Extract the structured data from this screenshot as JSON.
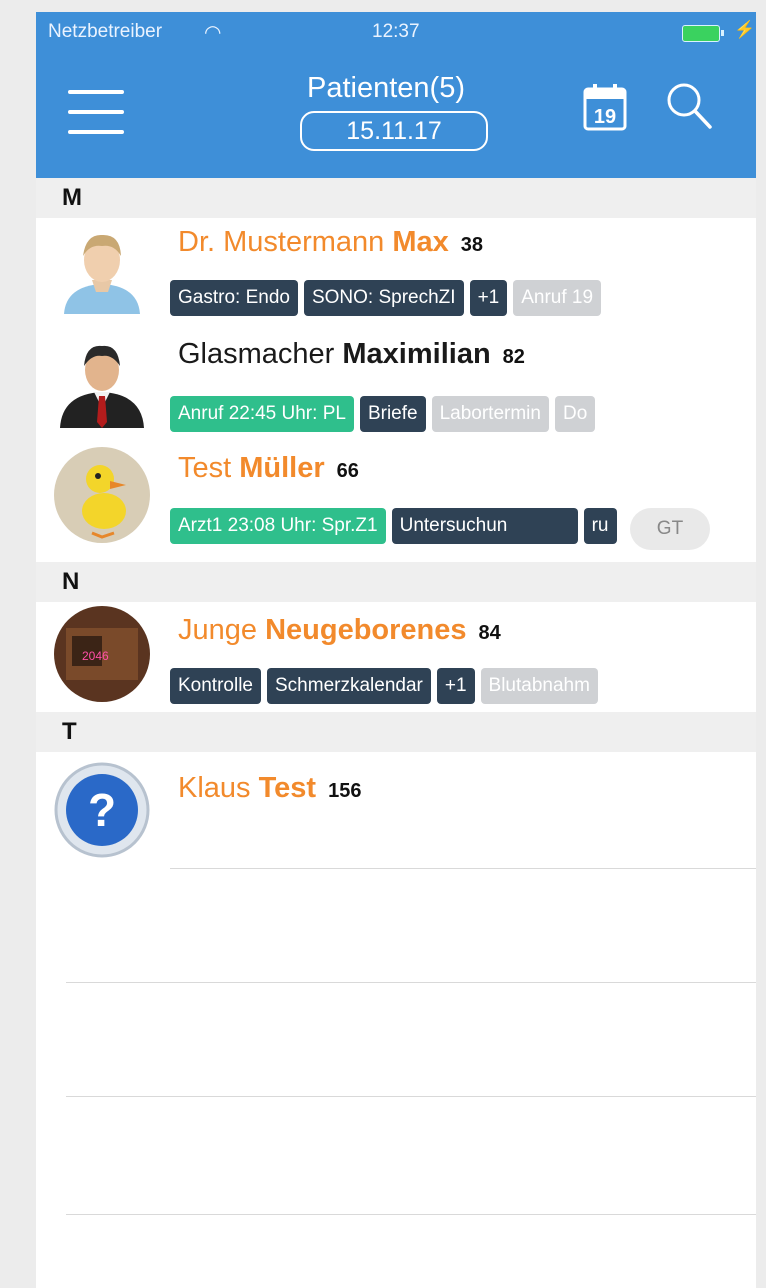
{
  "status_bar": {
    "carrier": "Netzbetreiber",
    "time": "12:37"
  },
  "header": {
    "title": "Patienten(5)",
    "date": "15.11.17",
    "calendar_day": "19"
  },
  "sections": [
    {
      "letter": "M"
    },
    {
      "letter": "N"
    },
    {
      "letter": "T"
    }
  ],
  "patients": [
    {
      "first": "Dr. Mustermann",
      "last": "Max",
      "age": "38",
      "tags": [
        "Gastro: Endo",
        "SONO: SprechZI",
        "+1",
        "Anruf 19"
      ]
    },
    {
      "first": "Glasmacher",
      "last": "Maximilian",
      "age": "82",
      "tags": [
        "Anruf 22:45 Uhr: PL",
        "Briefe",
        "Labortermin",
        "Do"
      ]
    },
    {
      "first": "Test",
      "last": "Müller",
      "age": "66",
      "tags": [
        "Arzt1 23:08 Uhr: Spr.Z1",
        "Untersuchun",
        "ru"
      ]
    },
    {
      "first": "Junge",
      "last": "Neugeborenes",
      "age": "84",
      "tags": [
        "Kontrolle",
        "Schmerzkalendar",
        "+1",
        "Blutabnahm"
      ]
    },
    {
      "first": "Klaus",
      "last": "Test",
      "age": "156",
      "tags": []
    }
  ],
  "bubble": {
    "text": "GT"
  },
  "avatar_photo_text": "2046"
}
